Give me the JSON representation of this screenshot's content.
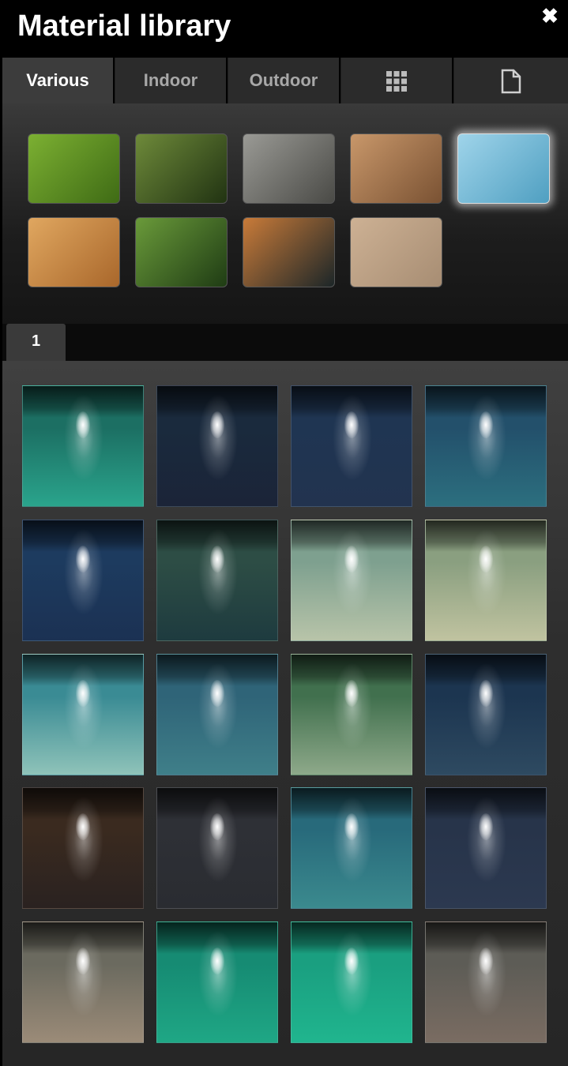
{
  "window": {
    "title": "Material library",
    "close_icon": "close-icon"
  },
  "tabs": [
    {
      "label": "Various",
      "active": true
    },
    {
      "label": "Indoor",
      "active": false
    },
    {
      "label": "Outdoor",
      "active": false
    },
    {
      "icon": "grid-icon"
    },
    {
      "icon": "document-icon"
    }
  ],
  "categories": [
    {
      "name": "grass-material-swatch",
      "colors": [
        "#7cb032",
        "#3f6b15"
      ]
    },
    {
      "name": "bamboo-leaves-material-swatch",
      "colors": [
        "#6e8a3a",
        "#213312"
      ]
    },
    {
      "name": "stone-wall-material-swatch",
      "colors": [
        "#9a9a95",
        "#4a4a46"
      ]
    },
    {
      "name": "gravel-material-swatch",
      "colors": [
        "#c8976a",
        "#7a5233"
      ]
    },
    {
      "name": "water-material-swatch",
      "colors": [
        "#9fd4ea",
        "#4f9fc1"
      ],
      "selected": true
    },
    {
      "name": "wood-rings-material-swatch",
      "colors": [
        "#e0a760",
        "#a9672b"
      ]
    },
    {
      "name": "green-leaves-material-swatch",
      "colors": [
        "#6a9a3a",
        "#1f3c14"
      ]
    },
    {
      "name": "copper-sculpture-material-swatch",
      "colors": [
        "#c97b39",
        "#1c2628"
      ]
    },
    {
      "name": "sand-material-swatch",
      "colors": [
        "#cdb194",
        "#a78d73"
      ]
    }
  ],
  "pagination": {
    "current_page": "1"
  },
  "water_thumbnails": [
    {
      "top": "#1c6f63",
      "bottom": "#2aa48c"
    },
    {
      "top": "#1a2a3d",
      "bottom": "#1b2438"
    },
    {
      "top": "#1f3552",
      "bottom": "#22334f"
    },
    {
      "top": "#23506b",
      "bottom": "#2c6f7f"
    },
    {
      "top": "#1d3b5f",
      "bottom": "#1b3153"
    },
    {
      "top": "#2d4d45",
      "bottom": "#1e3b3f"
    },
    {
      "top": "#7ea08f",
      "bottom": "#b8c4a9"
    },
    {
      "top": "#8a9f80",
      "bottom": "#c0c3a0"
    },
    {
      "top": "#3a8b94",
      "bottom": "#8fc3b9"
    },
    {
      "top": "#2f6478",
      "bottom": "#3f7f89"
    },
    {
      "top": "#41704e",
      "bottom": "#8ea98a"
    },
    {
      "top": "#1c3550",
      "bottom": "#2e4a61"
    },
    {
      "top": "#3a2a1f",
      "bottom": "#2a2220"
    },
    {
      "top": "#2e3036",
      "bottom": "#2a2c31"
    },
    {
      "top": "#286a7b",
      "bottom": "#3b8a8e"
    },
    {
      "top": "#27344a",
      "bottom": "#2c3950"
    },
    {
      "top": "#6b6a5f",
      "bottom": "#9b8b78"
    },
    {
      "top": "#168b73",
      "bottom": "#1fa785"
    },
    {
      "top": "#1a9f80",
      "bottom": "#20b58e"
    },
    {
      "top": "#5d5c56",
      "bottom": "#7a6c62"
    }
  ]
}
